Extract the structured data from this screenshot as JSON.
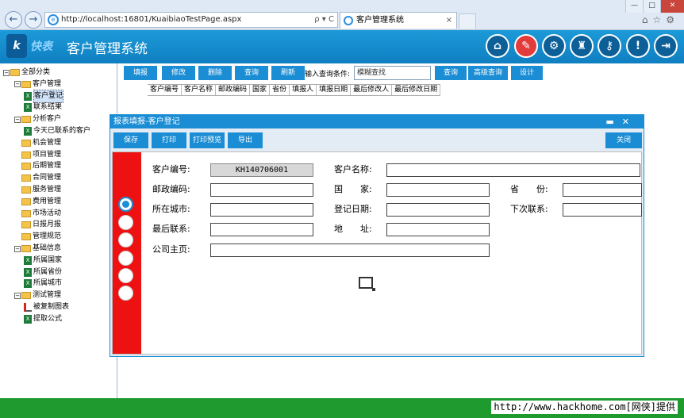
{
  "browser": {
    "url": "http://localhost:16801/KuaibiaoTestPage.aspx",
    "url_controls": "ρ ▾ C",
    "tab_title": "客户管理系统",
    "tab_close": "×",
    "back_icon": "←",
    "forward_icon": "→",
    "win_min": "—",
    "win_max": "□",
    "win_close": "✕",
    "icons": "⌂☆⚙"
  },
  "app": {
    "logo_mark": "k",
    "logo_text": "快表",
    "title": "客户管理系统",
    "header_icons": [
      {
        "name": "home-icon",
        "glyph": "⌂"
      },
      {
        "name": "form-icon",
        "glyph": "✎"
      },
      {
        "name": "settings-icon",
        "glyph": "⚙"
      },
      {
        "name": "shirt-icon",
        "glyph": "♜"
      },
      {
        "name": "key-icon",
        "glyph": "⚷"
      },
      {
        "name": "info-icon",
        "glyph": "!"
      },
      {
        "name": "exit-icon",
        "glyph": "⇥"
      }
    ]
  },
  "tree": {
    "expand_minus": "−",
    "items": [
      {
        "label": "全部分类",
        "type": "folder",
        "expand": true,
        "level": 0
      },
      {
        "label": "客户管理",
        "type": "folder",
        "expand": true,
        "level": 1
      },
      {
        "label": "客户登记",
        "type": "sheet",
        "level": 2,
        "selected": true
      },
      {
        "label": "联系结果",
        "type": "sheet",
        "level": 2
      },
      {
        "label": "分析客户",
        "type": "folder",
        "expand": true,
        "level": 1
      },
      {
        "label": "今天已联系的客户",
        "type": "sheet",
        "level": 2
      },
      {
        "label": "机会管理",
        "type": "folder",
        "level": 1
      },
      {
        "label": "项目管理",
        "type": "folder",
        "level": 1
      },
      {
        "label": "后期管理",
        "type": "folder",
        "level": 1
      },
      {
        "label": "合同管理",
        "type": "folder",
        "level": 1
      },
      {
        "label": "服务管理",
        "type": "folder",
        "level": 1
      },
      {
        "label": "费用管理",
        "type": "folder",
        "level": 1
      },
      {
        "label": "市场活动",
        "type": "folder",
        "level": 1
      },
      {
        "label": "日报月报",
        "type": "folder",
        "level": 1
      },
      {
        "label": "管理规范",
        "type": "folder",
        "level": 1
      },
      {
        "label": "基础信息",
        "type": "folder",
        "expand": true,
        "level": 1
      },
      {
        "label": "所属国家",
        "type": "sheet",
        "level": 2
      },
      {
        "label": "所属省份",
        "type": "sheet",
        "level": 2
      },
      {
        "label": "所属城市",
        "type": "sheet",
        "level": 2
      },
      {
        "label": "测试管理",
        "type": "folder",
        "expand": true,
        "level": 1
      },
      {
        "label": "被复制图表",
        "type": "chart",
        "level": 2
      },
      {
        "label": "提取公式",
        "type": "sheet",
        "level": 2
      }
    ]
  },
  "toolbar": {
    "buttons": [
      "填报",
      "修改",
      "删除",
      "查询",
      "刷新"
    ],
    "query_label": "输入查询条件:",
    "query_value": "模糊查找",
    "right_buttons": [
      "查询",
      "高级查询",
      "设计"
    ]
  },
  "columns": [
    "客户编号",
    "客户名称",
    "邮政编码",
    "国家",
    "省份",
    "填报人",
    "填报日期",
    "最后修改人",
    "最后修改日期"
  ],
  "dialog": {
    "title": "报表填报-客户登记",
    "title_controls": "▬✕",
    "buttons": [
      "保存",
      "打印",
      "打印预览",
      "导出"
    ],
    "close_button": "关闭",
    "fields": {
      "customer_no_label": "客户编号:",
      "customer_no_value": "KH140706001",
      "customer_name_label": "客户名称:",
      "postcode_label": "邮政编码:",
      "country_label": "国　　家:",
      "province_label": "省　　份:",
      "city_label": "所在城市:",
      "reg_date_label": "登记日期:",
      "next_contact_label": "下次联系:",
      "last_contact_label": "最后联系:",
      "address_label": "地　　址:",
      "homepage_label": "公司主页:"
    }
  },
  "footer": {
    "watermark": "http://www.hackhome.com[网侠]提供"
  }
}
